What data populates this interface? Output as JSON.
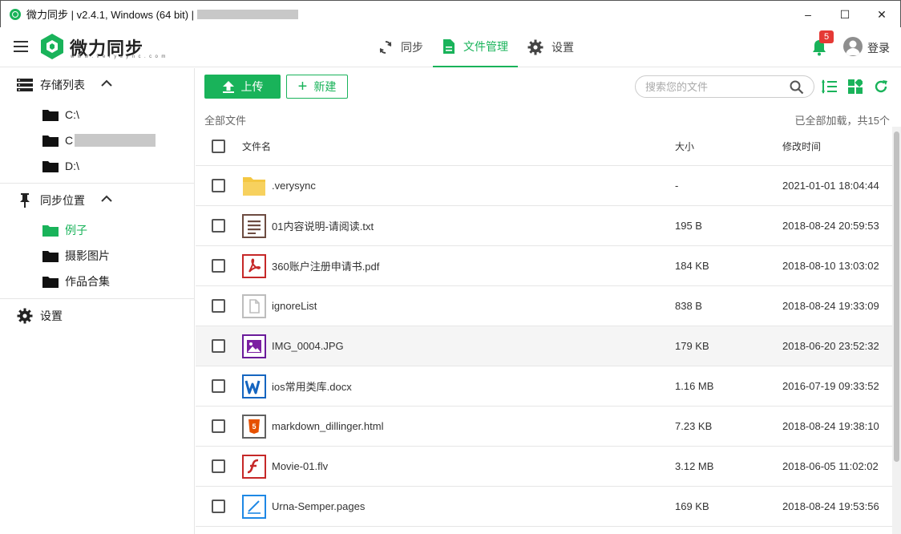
{
  "window": {
    "title": "微力同步 | v2.4.1, Windows (64 bit) |",
    "controls": [
      "–",
      "☐",
      "✕"
    ]
  },
  "header": {
    "brand": "微力同步",
    "brand_sub": "w w w . v e r y s y n c . c o m",
    "nav": [
      {
        "label": "同步",
        "icon": "sync-icon"
      },
      {
        "label": "文件管理",
        "icon": "document-icon",
        "active": true
      },
      {
        "label": "设置",
        "icon": "gear-icon"
      }
    ],
    "notification_count": "5",
    "login": "登录"
  },
  "sidebar": {
    "storage_title": "存储列表",
    "storage_items": [
      "C:\\",
      "C",
      "D:\\"
    ],
    "sync_title": "同步位置",
    "sync_items": [
      "例子",
      "摄影图片",
      "作品合集"
    ],
    "settings": "设置"
  },
  "toolbar": {
    "upload": "上传",
    "new": "新建",
    "search_placeholder": "搜索您的文件"
  },
  "breadcrumb": "全部文件",
  "loaded_status": "已全部加载，共15个",
  "table": {
    "headers": {
      "name": "文件名",
      "size": "大小",
      "time": "修改时间"
    },
    "rows": [
      {
        "name": ".verysync",
        "size": "-",
        "time": "2021-01-01 18:04:44",
        "icon": "folder-icon"
      },
      {
        "name": "01内容说明-请阅读.txt",
        "size": "195 B",
        "time": "2018-08-24 20:59:53",
        "icon": "text-file-icon"
      },
      {
        "name": "360账户注册申请书.pdf",
        "size": "184 KB",
        "time": "2018-08-10 13:03:02",
        "icon": "pdf-file-icon"
      },
      {
        "name": "ignoreList",
        "size": "838 B",
        "time": "2018-08-24 19:33:09",
        "icon": "blank-file-icon"
      },
      {
        "name": "IMG_0004.JPG",
        "size": "179 KB",
        "time": "2018-06-20 23:52:32",
        "icon": "image-file-icon"
      },
      {
        "name": "ios常用类库.docx",
        "size": "1.16 MB",
        "time": "2016-07-19 09:33:52",
        "icon": "word-file-icon"
      },
      {
        "name": "markdown_dillinger.html",
        "size": "7.23 KB",
        "time": "2018-08-24 19:38:10",
        "icon": "html-file-icon"
      },
      {
        "name": "Movie-01.flv",
        "size": "3.12 MB",
        "time": "2018-06-05 11:02:02",
        "icon": "flash-file-icon"
      },
      {
        "name": "Urna-Semper.pages",
        "size": "169 KB",
        "time": "2018-08-24 19:53:56",
        "icon": "pages-file-icon"
      }
    ]
  },
  "colors": {
    "accent": "#19b35a",
    "badge": "#e53935"
  }
}
